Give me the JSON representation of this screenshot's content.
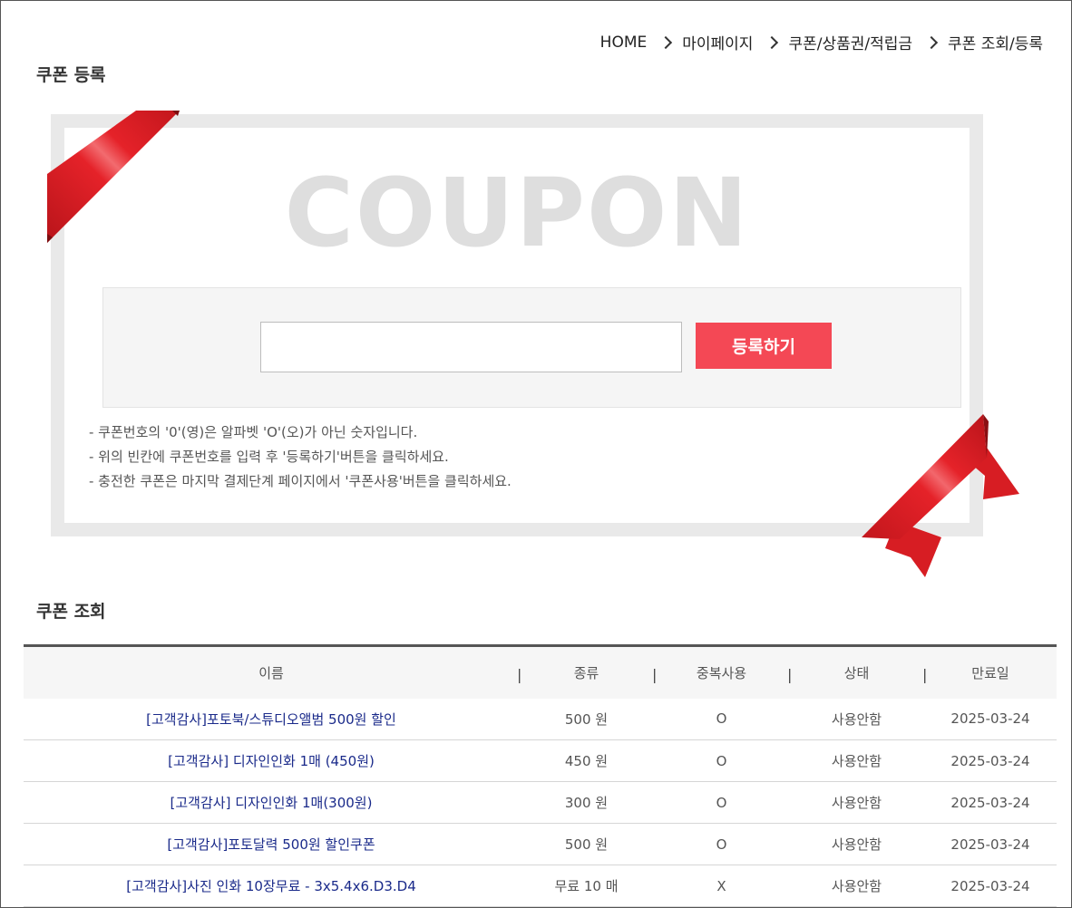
{
  "breadcrumb": [
    "HOME",
    "마이페이지",
    "쿠폰/상품권/적립금",
    "쿠폰 조회/등록"
  ],
  "register_section": {
    "title": "쿠폰 등록",
    "coupon_word": "COUPON",
    "input_value": "",
    "button_label": "등록하기",
    "notes": [
      "- 쿠폰번호의 '0'(영)은 알파벳 'O'(오)가 아닌 숫자입니다.",
      "- 위의 빈칸에 쿠폰번호를 입력 후 '등록하기'버튼을 클릭하세요.",
      "- 충전한 쿠폰은 마지막 결제단계 페이지에서 '쿠폰사용'버튼을 클릭하세요."
    ]
  },
  "lookup_section": {
    "title": "쿠폰 조회",
    "columns": [
      "이름",
      "종류",
      "중복사용",
      "상태",
      "만료일"
    ],
    "column_separator": "|",
    "rows": [
      {
        "name": "[고객감사]포토북/스튜디오앨범 500원 할인",
        "type": "500 원",
        "dup": "O",
        "status": "사용안함",
        "expiry": "2025-03-24"
      },
      {
        "name": "[고객감사] 디자인인화 1매 (450원)",
        "type": "450 원",
        "dup": "O",
        "status": "사용안함",
        "expiry": "2025-03-24"
      },
      {
        "name": "[고객감사] 디자인인화 1매(300원)",
        "type": "300 원",
        "dup": "O",
        "status": "사용안함",
        "expiry": "2025-03-24"
      },
      {
        "name": "[고객감사]포토달력 500원 할인쿠폰",
        "type": "500 원",
        "dup": "O",
        "status": "사용안함",
        "expiry": "2025-03-24"
      },
      {
        "name": "[고객감사]사진 인화 10장무료 - 3x5.4x6.D3.D4",
        "type": "무료 10 매",
        "dup": "X",
        "status": "사용안함",
        "expiry": "2025-03-24"
      }
    ]
  },
  "colors": {
    "accent_button": "#f44855",
    "ribbon_red": "#e02027",
    "link_text": "#1a2a8a"
  }
}
